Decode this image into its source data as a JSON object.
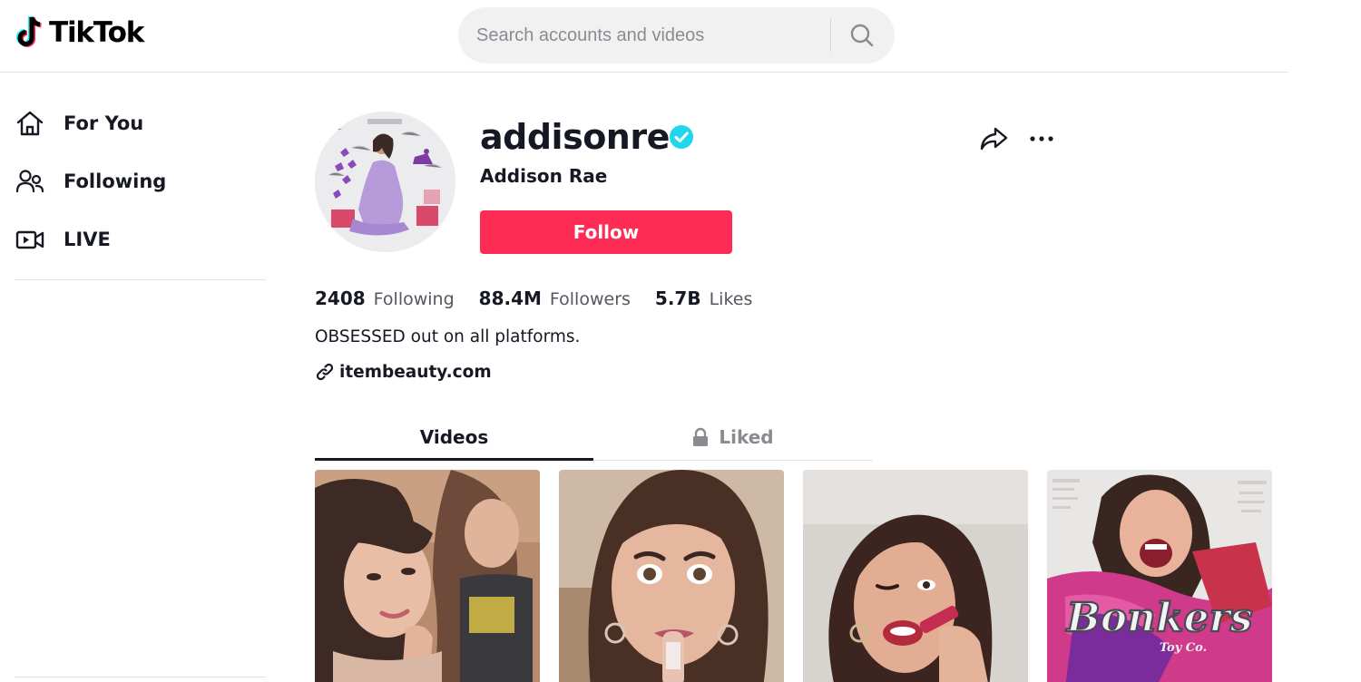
{
  "app": {
    "brand": "TikTok",
    "accent_color": "#fe2c55",
    "verified_color": "#20d5ec"
  },
  "header": {
    "logo_text": "TikTok",
    "search": {
      "placeholder": "Search accounts and videos",
      "value": "",
      "icon": "search-icon"
    }
  },
  "sidebar": {
    "items": [
      {
        "label": "For You",
        "icon": "home-icon"
      },
      {
        "label": "Following",
        "icon": "people-icon"
      },
      {
        "label": "LIVE",
        "icon": "live-camera-icon"
      }
    ]
  },
  "profile": {
    "username": "addisonre",
    "verified": true,
    "display_name": "Addison Rae",
    "follow_label": "Follow",
    "share_icon": "share-arrow-icon",
    "more_icon": "more-dots-icon",
    "stats": {
      "following": {
        "value": "2408",
        "label": "Following"
      },
      "followers": {
        "value": "88.4M",
        "label": "Followers"
      },
      "likes": {
        "value": "5.7B",
        "label": "Likes"
      }
    },
    "bio": "OBSESSED out on all platforms.",
    "link": {
      "text": "itembeauty.com",
      "icon": "link-icon"
    }
  },
  "tabs": {
    "videos": {
      "label": "Videos",
      "active": true
    },
    "liked": {
      "label": "Liked",
      "locked": true,
      "icon": "lock-icon"
    }
  },
  "videos": [
    {
      "id": "video-1"
    },
    {
      "id": "video-2"
    },
    {
      "id": "video-3"
    },
    {
      "id": "video-4",
      "overlay_text": "Bonkers",
      "overlay_subtext": "Toy Co."
    }
  ]
}
